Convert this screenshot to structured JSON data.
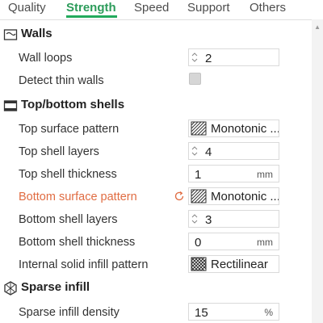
{
  "tabs": [
    {
      "label": "Quality",
      "active": false
    },
    {
      "label": "Strength",
      "active": true
    },
    {
      "label": "Speed",
      "active": false
    },
    {
      "label": "Support",
      "active": false
    },
    {
      "label": "Others",
      "active": false
    }
  ],
  "sections": {
    "walls": {
      "title": "Walls",
      "icon": "walls-icon"
    },
    "shells": {
      "title": "Top/bottom shells",
      "icon": "shells-icon"
    },
    "infill": {
      "title": "Sparse infill",
      "icon": "infill-icon"
    }
  },
  "settings": {
    "wall_loops": {
      "label": "Wall loops",
      "value": "2"
    },
    "detect_thin_walls": {
      "label": "Detect thin walls",
      "checked": false
    },
    "top_surface_pattern": {
      "label": "Top surface pattern",
      "value": "Monotonic ...",
      "icon": "monotonic-pattern-icon"
    },
    "top_shell_layers": {
      "label": "Top shell layers",
      "value": "4"
    },
    "top_shell_thickness": {
      "label": "Top shell thickness",
      "value": "1",
      "unit": "mm"
    },
    "bottom_surface_pattern": {
      "label": "Bottom surface pattern",
      "value": "Monotonic ...",
      "icon": "monotonic-pattern-icon",
      "modified": true
    },
    "bottom_shell_layers": {
      "label": "Bottom shell layers",
      "value": "3"
    },
    "bottom_shell_thickness": {
      "label": "Bottom shell thickness",
      "value": "0",
      "unit": "mm"
    },
    "internal_solid_infill_pattern": {
      "label": "Internal solid infill pattern",
      "value": "Rectilinear",
      "icon": "rectilinear-pattern-icon"
    },
    "sparse_infill_density": {
      "label": "Sparse infill density",
      "value": "15",
      "unit": "%"
    }
  },
  "colors": {
    "accent": "#22aa5c",
    "modified_label": "#e06c42"
  }
}
